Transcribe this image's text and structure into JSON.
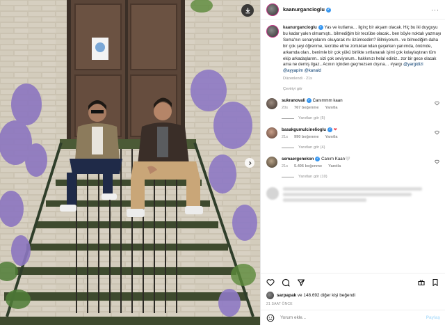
{
  "post": {
    "username": "kaanurgancioglu",
    "caption_user": "kaanurgancioglu",
    "caption_body": "Yas ve kutlama… ilginç bir akşam olacak. Hiç bu iki duyguyu bu kadar yakın olmamıştı.. bilmediğim bir tecrübe olacak.. ben böyle noktalı yazmayı Sema'nın senaryolarını okuyarak mı özümsedim? Bilmiyorum.. ve bilmediğim daha bir çok şeyi öğrenme, tecrübe etme zorluklarından geçerken yanımda, önümde, arkamda olan.. benimle bir çok yükü birlikte sırtlanarak işimi çok kolaylaştıran tüm ekip arkadaşlarım.. sizi çok seviyorum.. hakkınızı helal ediniz.. zor bir gece olacak ama ne demiş ilgaz.. Acının içinden geçmezsen dışına… #yargı",
    "caption_tags": "@yargidizi @ayyapim @kanald",
    "edited_label": "Düzenlendi · 21s",
    "translation_label": "Çeviriyi gör"
  },
  "comments": [
    {
      "username": "sukranovali",
      "text": "Canımmm kaan",
      "heart": "",
      "time": "20s",
      "likes": "767 beğenme",
      "reply": "Yanıtla",
      "replies": "Yanıtları gör (5)"
    },
    {
      "username": "basakgumulcinelioglu",
      "text": "",
      "heart": "❤",
      "time": "21s",
      "likes": "990 beğenme",
      "reply": "Yanıtla",
      "replies": "Yanıtları gör (4)"
    },
    {
      "username": "semaergenekon",
      "text": "Canım Kaan🤍",
      "heart": "",
      "time": "21s",
      "likes": "5.406 beğenme",
      "reply": "Yanıtla",
      "replies": "Yanıtları gör (10)"
    }
  ],
  "actions": {
    "liked_by_user": "sarpapak",
    "liked_by_rest": "ve 148.692 diğer kişi beğendi",
    "time_ago": "21 SAAT ÖNCE",
    "comment_placeholder": "Yorum ekle...",
    "post_label": "Paylaş"
  },
  "icons": {
    "save": "save-icon",
    "next": "chevron-right-icon",
    "more": "more-icon",
    "like": "heart-icon",
    "comment": "comment-icon",
    "share": "share-icon",
    "bookmark": "bookmark-icon",
    "emoji": "emoji-icon"
  },
  "colors": {
    "verified": "#3897f0",
    "link": "#00376b",
    "like_red": "#ed4956",
    "muted": "#8e8e8e"
  }
}
